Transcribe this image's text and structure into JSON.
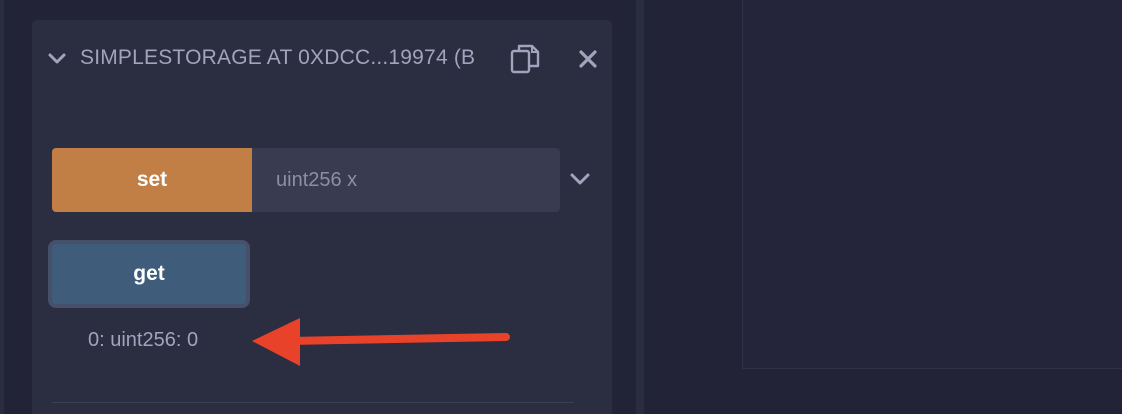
{
  "contract": {
    "title": "SIMPLESTORAGE AT 0XDCC...19974 (B",
    "collapse_icon": "chevron-down-icon",
    "copy_icon": "copy-icon",
    "close_icon": "close-icon"
  },
  "functions": {
    "set": {
      "label": "set",
      "input_placeholder": "uint256 x",
      "input_value": "",
      "expand_icon": "chevron-down-icon",
      "color": "#c17f45"
    },
    "get": {
      "label": "get",
      "color": "#3f5d7b",
      "result": "0: uint256: 0"
    }
  },
  "annotation": {
    "arrow_color": "#e8432a",
    "arrow_icon": "left-arrow-icon"
  }
}
